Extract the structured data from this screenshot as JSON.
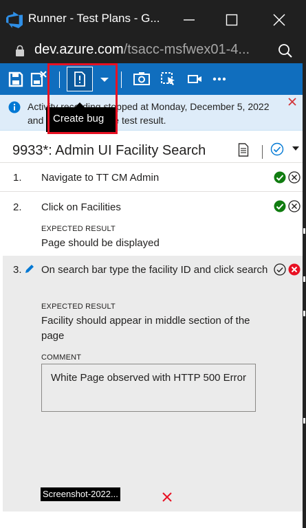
{
  "window": {
    "title": "Runner - Test Plans - G...",
    "minimize_icon": "minimize-icon",
    "maximize_icon": "maximize-icon",
    "close_icon": "close-icon"
  },
  "address_bar": {
    "host": "dev.azure.com",
    "path": "/tsacc-msfwex01-4..."
  },
  "toolbar": {
    "icons": [
      "save-icon",
      "save-and-close-icon",
      "create-bug-icon",
      "dropdown-icon",
      "capture-screenshot-icon",
      "capture-user-actions-icon",
      "record-screen-icon",
      "more-icon"
    ],
    "accent": "#106ebe"
  },
  "tooltip": {
    "label": "Create bug"
  },
  "banner": {
    "message": "Activity recording stopped at Monday, December 5, 2022 and attached with the test result."
  },
  "test_case": {
    "title": "9933*: Admin UI Facility Search"
  },
  "steps": [
    {
      "number": "1.",
      "action": "Navigate to TT CM Admin",
      "status": "passed"
    },
    {
      "number": "2.",
      "action": "Click on Facilities",
      "expected_label": "EXPECTED RESULT",
      "expected": "Page should be displayed",
      "status": "passed"
    },
    {
      "number": "3.",
      "action": "On search bar type the facility ID and click search",
      "expected_label": "EXPECTED RESULT",
      "expected": "Facility should appear in middle section of the page",
      "comment_label": "COMMENT",
      "comment": "White Page observed with HTTP 500 Error",
      "attachment": "Screenshot-2022...",
      "status": "failed"
    }
  ],
  "colors": {
    "pass": "#107c10",
    "fail": "#e81123",
    "highlight": "#e81123"
  }
}
